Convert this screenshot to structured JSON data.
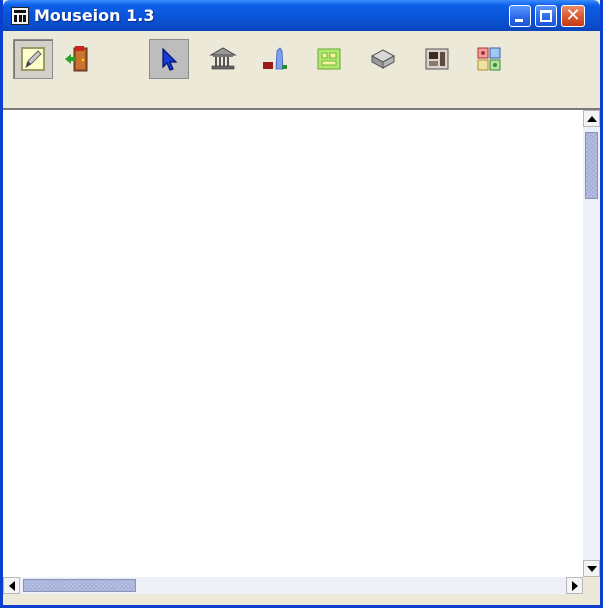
{
  "window": {
    "title": "Mouseion 1.3",
    "controls": [
      "minimize-icon",
      "maximize-icon",
      "close-icon"
    ],
    "accent_color": "#0a54d8",
    "close_color": "#d8522a"
  },
  "toolbar": {
    "tools": [
      {
        "name": "edit-icon",
        "state": "pressed"
      },
      {
        "name": "exit-door-icon",
        "state": "normal"
      },
      {
        "name": "pointer-cursor-icon",
        "state": "selected"
      },
      {
        "name": "museum-building-icon",
        "state": "normal"
      },
      {
        "name": "exhibit-objects-icon",
        "state": "normal"
      },
      {
        "name": "floor-plan-icon",
        "state": "normal"
      },
      {
        "name": "display-case-icon",
        "state": "normal"
      },
      {
        "name": "cabinet-icon",
        "state": "normal"
      },
      {
        "name": "gallery-frames-icon",
        "state": "normal"
      }
    ]
  },
  "canvas": {
    "background": "#ffffff"
  },
  "scrollbars": {
    "vertical": {
      "thumb_position_fraction": 0.05
    },
    "horizontal": {
      "thumb_position_fraction": 0.0
    }
  }
}
